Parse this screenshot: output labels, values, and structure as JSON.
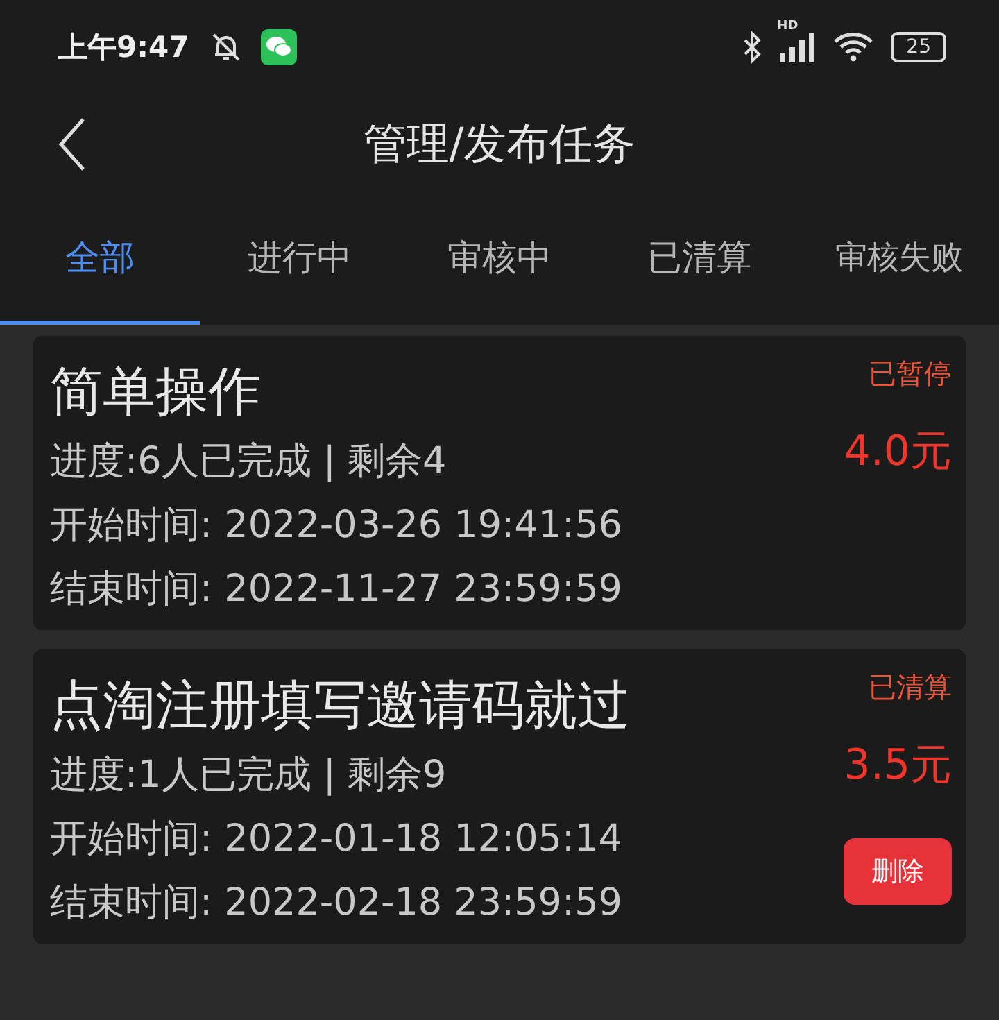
{
  "status_bar": {
    "time": "上午9:47",
    "network": "HD",
    "battery": "25"
  },
  "header": {
    "title": "管理/发布任务"
  },
  "tabs": [
    {
      "label": "全部",
      "selected": true
    },
    {
      "label": "进行中",
      "selected": false
    },
    {
      "label": "审核中",
      "selected": false
    },
    {
      "label": "已清算",
      "selected": false
    },
    {
      "label": "审核失败",
      "selected": false
    }
  ],
  "tasks": [
    {
      "title": "简单操作",
      "status": "已暂停",
      "progress": "进度:6人已完成 | 剩余4",
      "price": "4.0元",
      "start": "开始时间: 2022-03-26 19:41:56",
      "end": "结束时间: 2022-11-27 23:59:59"
    },
    {
      "title": "点淘注册填写邀请码就过",
      "status": "已清算",
      "progress": "进度:1人已完成 | 剩余9",
      "price": "3.5元",
      "start": "开始时间: 2022-01-18 12:05:14",
      "end": "结束时间: 2022-02-18 23:59:59",
      "button": "删除"
    }
  ]
}
